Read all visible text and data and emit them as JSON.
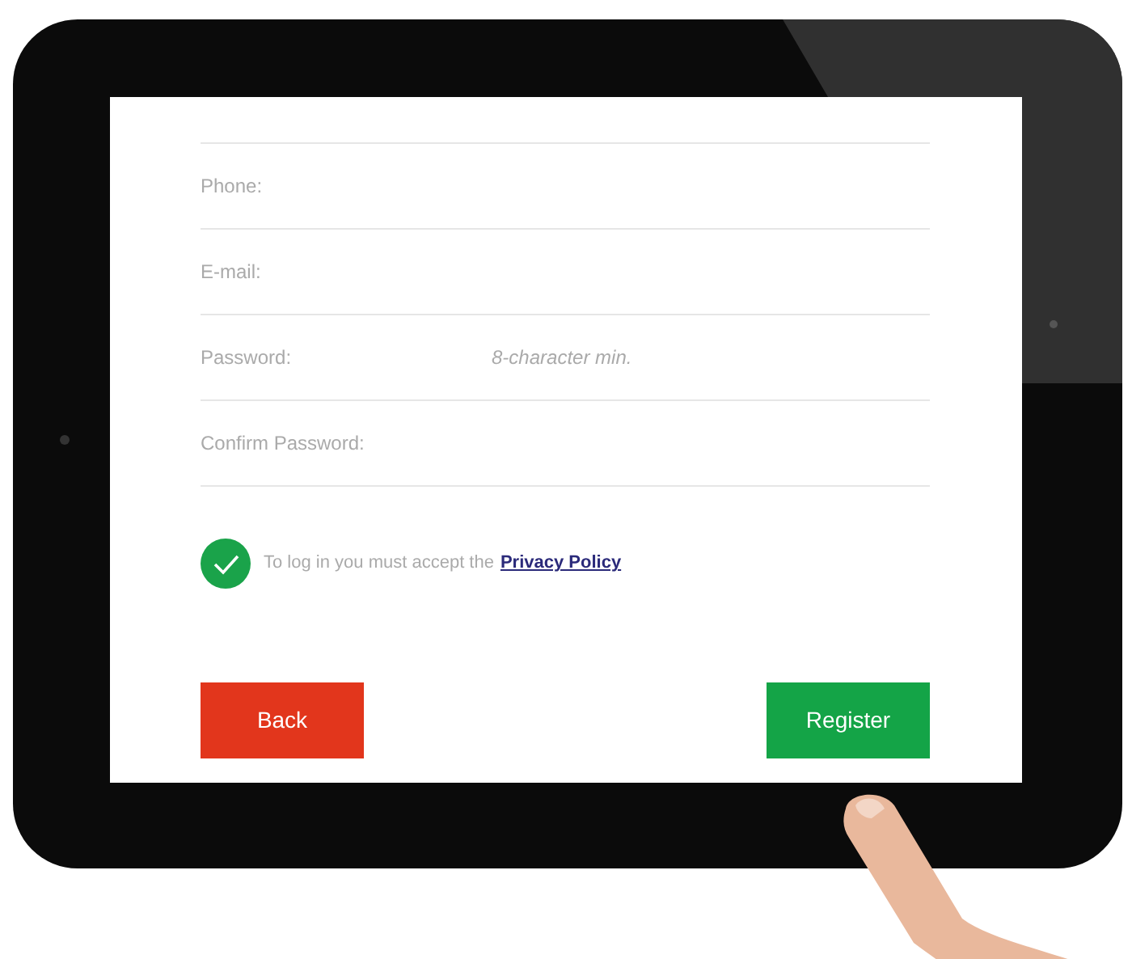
{
  "fields": [
    {
      "label": "Phone:"
    },
    {
      "label": "E-mail:"
    },
    {
      "label": "Password:",
      "placeholder": "8-character min."
    },
    {
      "label": "Confirm Password:"
    }
  ],
  "consent": {
    "checked": true,
    "text": "To log in you must accept the",
    "link": "Privacy Policy"
  },
  "buttons": [
    {
      "kind": "back",
      "label": "Back"
    },
    {
      "kind": "register",
      "label": "Register"
    }
  ]
}
